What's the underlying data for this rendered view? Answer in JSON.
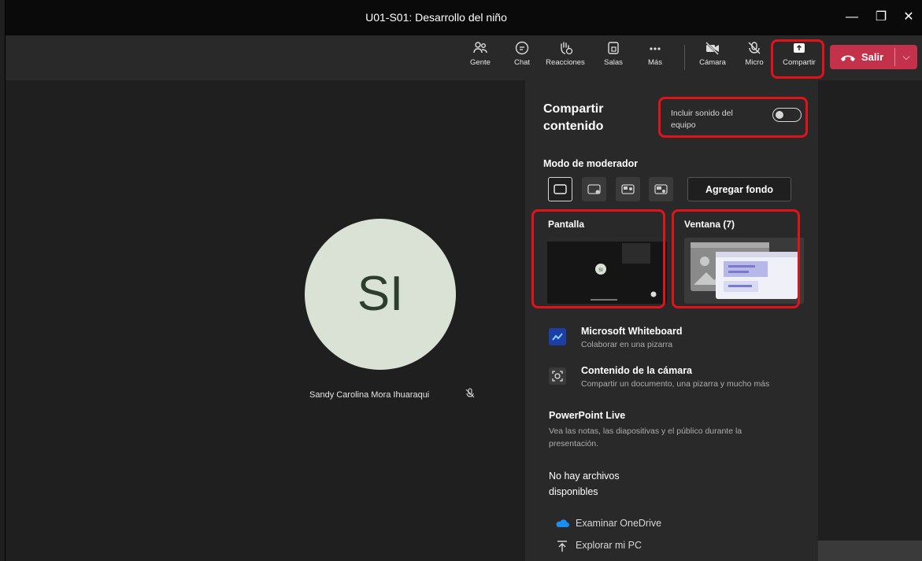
{
  "window": {
    "title": "U01-S01: Desarrollo del niño",
    "minimize_glyph": "—",
    "maximize_glyph": "❐",
    "close_glyph": "✕"
  },
  "toolbar": {
    "people_label": "Gente",
    "chat_label": "Chat",
    "reactions_label": "Reacciones",
    "rooms_label": "Salas",
    "more_label": "Más",
    "camera_label": "Cámara",
    "mic_label": "Micro",
    "share_label": "Compartir",
    "leave_label": "Salir",
    "leave_caret": "⌵"
  },
  "stage": {
    "avatar_initials": "SI",
    "participant_name": "Sandy Carolina Mora Ihuaraqui"
  },
  "share_panel": {
    "title": "Compartir contenido",
    "include_audio_label": "Incluir sonido del equipo",
    "include_audio_on": false,
    "presenter_mode_label": "Modo de moderador",
    "add_background_label": "Agregar fondo",
    "screen_label": "Pantalla",
    "window_label": "Ventana (7)",
    "screen_thumb_initials": "SI",
    "whiteboard_title": "Microsoft Whiteboard",
    "whiteboard_sub": "Colaborar en una pizarra",
    "camera_content_title": "Contenido de la cámara",
    "camera_content_sub": "Compartir un documento, una pizarra y mucho más",
    "ppt_title": "PowerPoint Live",
    "ppt_sub": "Vea las notas, las diapositivas y el público durante la presentación.",
    "no_files": "No hay archivos disponibles",
    "onedrive_label": "Examinar OneDrive",
    "pc_label": "Explorar mi PC"
  },
  "colors": {
    "leave_red": "#c4314b",
    "highlight_red": "#e0131b",
    "avatar_bg": "#dae2d6",
    "panel_bg": "#292929"
  }
}
